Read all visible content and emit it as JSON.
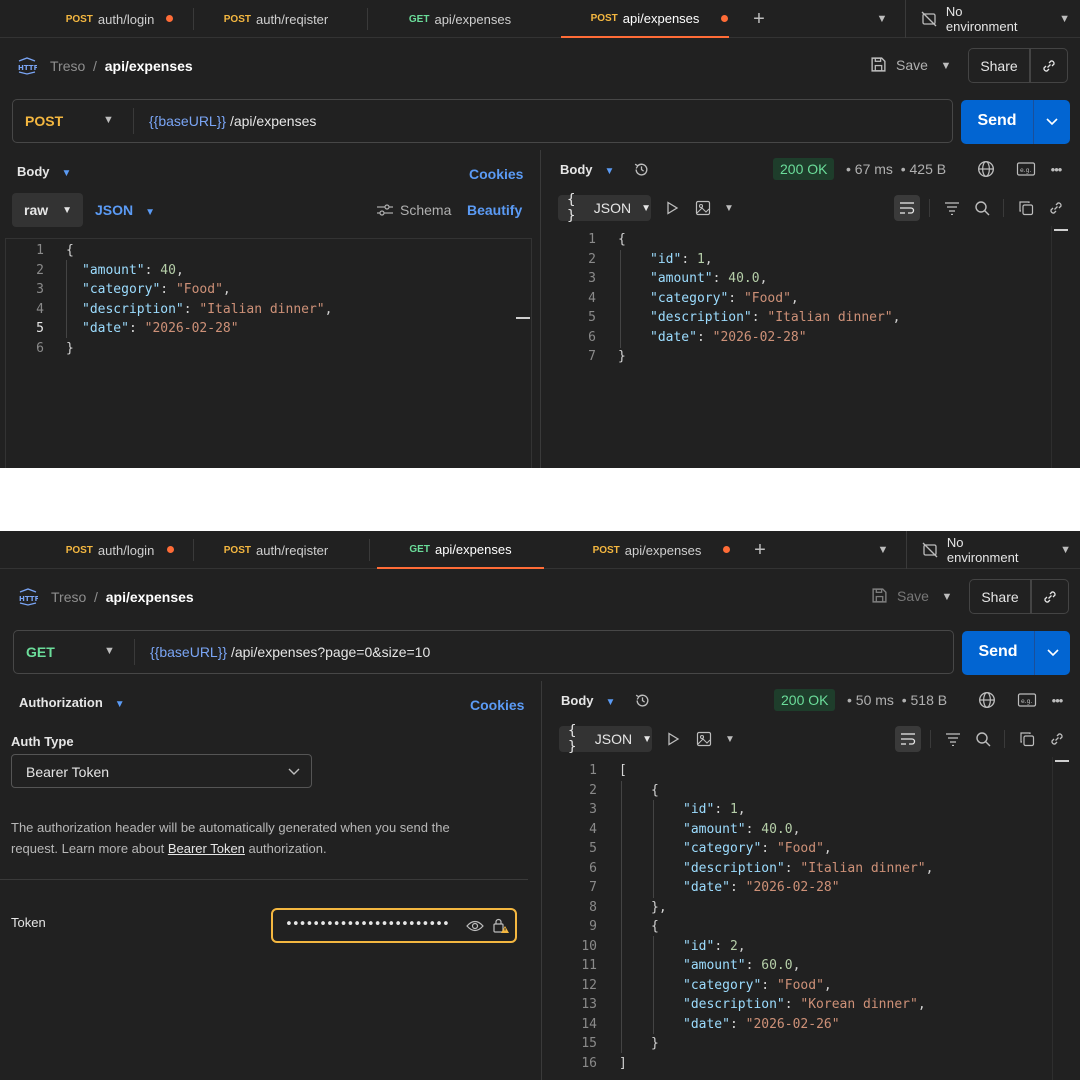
{
  "tabs": [
    {
      "method": "POST",
      "label": "auth/login",
      "dot": true
    },
    {
      "method": "POST",
      "label": "auth/reqister",
      "dot": false
    },
    {
      "method": "GET",
      "label": "api/expenses",
      "dot": false
    },
    {
      "method": "POST",
      "label": "api/expenses",
      "dot": true
    }
  ],
  "environment": "No environment",
  "workspace": "Treso",
  "request_name": "api/expenses",
  "save_label": "Save",
  "share_label": "Share",
  "send_label": "Send",
  "base_url_var": "{{baseURL}}",
  "cookies_label": "Cookies",
  "response_body_label": "Body",
  "json_label": "JSON",
  "screen1": {
    "method": "POST",
    "url_path": "/api/expenses",
    "left_tab": "Body",
    "raw_label": "raw",
    "format_label": "JSON",
    "schema_label": "Schema",
    "beautify_label": "Beautify",
    "status": "200 OK",
    "time": "67 ms",
    "size": "425 B",
    "request_lines": [
      "1",
      "2",
      "3",
      "4",
      "5",
      "6"
    ],
    "response_lines": [
      "1",
      "2",
      "3",
      "4",
      "5",
      "6",
      "7"
    ]
  },
  "screen2": {
    "method": "GET",
    "url_path": "/api/expenses?page=0&size=10",
    "left_tab": "Authorization",
    "auth_type_label": "Auth Type",
    "auth_type_value": "Bearer Token",
    "help_text_1": "The authorization header will be automatically generated when you send the",
    "help_text_2": "request. Learn more about ",
    "help_link": "Bearer Token",
    "help_text_3": " authorization.",
    "token_label": "Token",
    "token_value": "••••••••••••••••••••••••",
    "status": "200 OK",
    "time": "50 ms",
    "size": "518 B",
    "response_lines": [
      "1",
      "2",
      "3",
      "4",
      "5",
      "6",
      "7",
      "8",
      "9",
      "10",
      "11",
      "12",
      "13",
      "14",
      "15",
      "16"
    ]
  },
  "request_body": {
    "amount": "40",
    "category": "\"Food\"",
    "description": "\"Italian dinner\"",
    "date": "\"2026-02-28\""
  },
  "response1": {
    "id": "1",
    "amount": "40.0",
    "category": "\"Food\"",
    "description": "\"Italian dinner\"",
    "date": "\"2026-02-28\""
  },
  "response2": [
    {
      "id": "1",
      "amount": "40.0",
      "category": "\"Food\"",
      "description": "\"Italian dinner\"",
      "date": "\"2026-02-28\""
    },
    {
      "id": "2",
      "amount": "60.0",
      "category": "\"Food\"",
      "description": "\"Korean dinner\"",
      "date": "\"2026-02-26\""
    }
  ],
  "keys": {
    "id": "\"id\"",
    "amount": "\"amount\"",
    "category": "\"category\"",
    "description": "\"description\"",
    "date": "\"date\""
  },
  "punct": {
    "open_brace": "{",
    "close_brace": "}",
    "close_brace_comma": "},",
    "open_bracket": "[",
    "close_bracket": "]",
    "colon": ": ",
    "comma": ","
  },
  "icons": [
    "http-icon",
    "save-icon",
    "chevron-down-icon",
    "link-icon",
    "plus-icon",
    "no-environment-icon",
    "history-icon",
    "globe-icon",
    "example-icon",
    "more-icon",
    "play-icon",
    "image-icon",
    "wrap-icon",
    "filter-icon",
    "search-icon",
    "copy-icon",
    "eye-icon",
    "lock-warning-icon",
    "schema-icon"
  ]
}
